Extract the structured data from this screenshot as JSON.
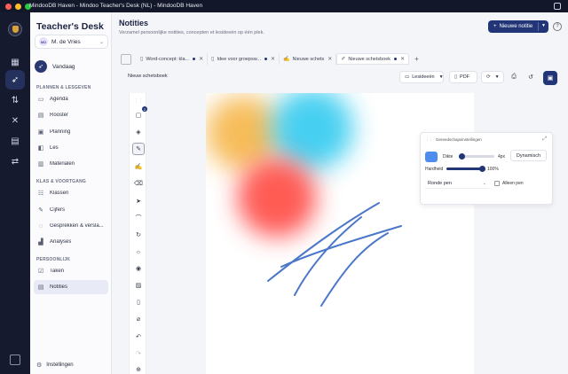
{
  "window": {
    "title": "MindooDB Haven - Mindoo Teacher's Desk (NL) - MindooDB Haven"
  },
  "brand": {
    "part1": "Teacher's ",
    "part2": "Desk"
  },
  "user": {
    "initials": "MD",
    "name": "M. de Vries"
  },
  "sidebar": {
    "today": "Vandaag",
    "sections": [
      {
        "title": "PLANNEN & LESGEVEN",
        "items": [
          "Agenda",
          "Rooster",
          "Planning",
          "Les",
          "Materialen"
        ]
      },
      {
        "title": "KLAS & VOORTGANG",
        "items": [
          "Klassen",
          "Cijfers",
          "Gesprekken & versla...",
          "Analyses"
        ]
      },
      {
        "title": "PERSOONLIJK",
        "items": [
          "Taken",
          "Notities"
        ]
      }
    ],
    "settings": "Instellingen"
  },
  "main": {
    "title": "Notities",
    "subtitle": "Verzamel persoonlijke notities, concepten et lesideeën op één plek.",
    "new_button": "Nieuwe notitie"
  },
  "tabs": [
    {
      "label": "Word-concept: kla...",
      "icon": "document-icon",
      "dirty": true,
      "active": false
    },
    {
      "label": "Idee voor groepsw...",
      "icon": "document-icon",
      "dirty": true,
      "active": false
    },
    {
      "label": "Nieuwe schets",
      "icon": "brush-icon",
      "dirty": false,
      "active": false
    },
    {
      "label": "Nieuwe schetsboek",
      "icon": "sketchbook-icon",
      "dirty": true,
      "active": true
    }
  ],
  "toolbar": {
    "doc_name": "Nieuw schetsboek",
    "lesideeen": "Lesideeën",
    "pdf": "PDF"
  },
  "tools": {
    "badge": "2"
  },
  "brush": {
    "header": "Gereedschapsinstellingen",
    "color": "#4f8cf0",
    "dikte_label": "Dikte",
    "dikte_value": "4px",
    "dikte_fraction": 0.08,
    "hardheid_label": "Hardheid",
    "hardheid_value": "100%",
    "hardheid_fraction": 1.0,
    "dynamic_label": "Dynamisch",
    "pen_type": "Ronde pen",
    "only_pen_label": "Alleen pen"
  },
  "colors": {
    "accent": "#223577",
    "sidebar_dark": "#151a2e"
  }
}
